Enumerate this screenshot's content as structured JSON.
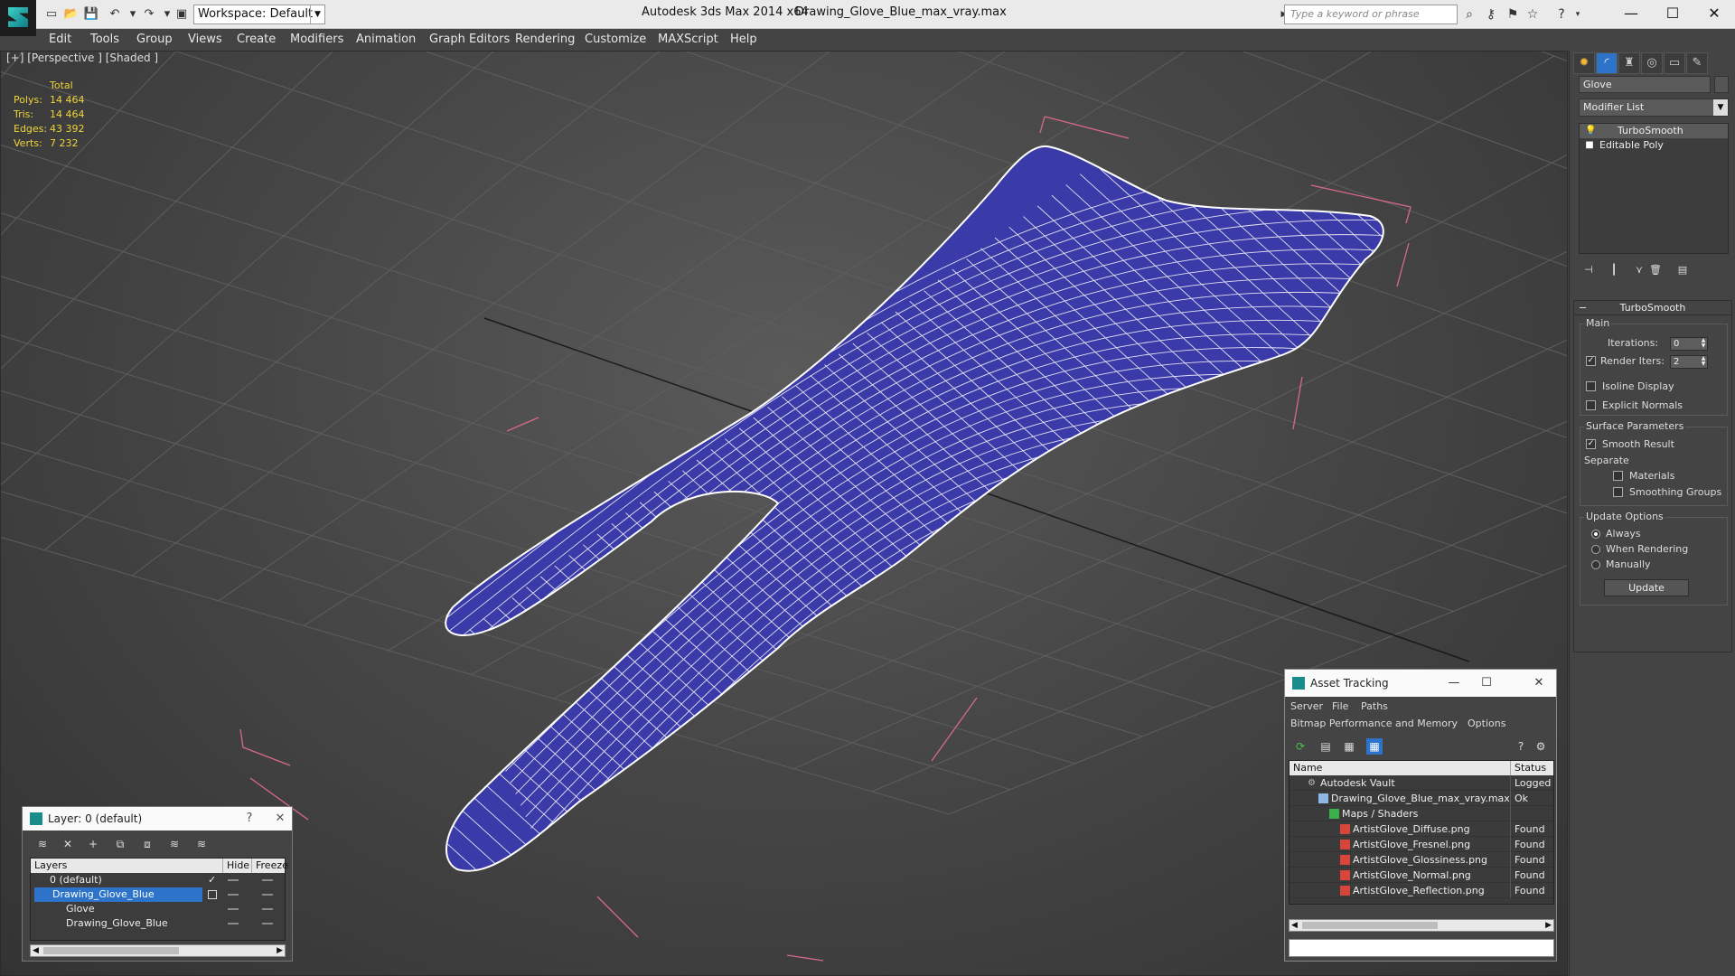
{
  "titlebar": {
    "workspace": "Workspace: Default",
    "app_title": "Autodesk 3ds Max  2014 x64",
    "doc_title": "Drawing_Glove_Blue_max_vray.max",
    "search_placeholder": "Type a keyword or phrase"
  },
  "menu": [
    "Edit",
    "Tools",
    "Group",
    "Views",
    "Create",
    "Modifiers",
    "Animation",
    "Graph Editors",
    "Rendering",
    "Customize",
    "MAXScript",
    "Help"
  ],
  "viewport": {
    "label": "[+] [Perspective ] [Shaded ]",
    "stats": {
      "header": "Total",
      "polys_label": "Polys:",
      "polys": "14 464",
      "tris_label": "Tris:",
      "tris": "14 464",
      "edges_label": "Edges:",
      "edges": "43 392",
      "verts_label": "Verts:",
      "verts": "7 232"
    },
    "mesh_color": "#3a3aa8",
    "wire_color": "#ffffff",
    "bbox_color": "#d86a86"
  },
  "command_panel": {
    "object_name": "Glove",
    "modifier_list": "Modifier List",
    "stack": [
      "TurboSmooth",
      "Editable Poly"
    ],
    "turbosmooth": {
      "title": "TurboSmooth",
      "main_label": "Main",
      "iterations_label": "Iterations:",
      "iterations": "0",
      "render_iters_label": "Render Iters:",
      "render_iters": "2",
      "isoline_label": "Isoline Display",
      "explicit_normals_label": "Explicit Normals",
      "surface_params_label": "Surface Parameters",
      "smooth_result_label": "Smooth Result",
      "separate_label": "Separate",
      "materials_label": "Materials",
      "smoothing_groups_label": "Smoothing Groups",
      "update_options_label": "Update Options",
      "always_label": "Always",
      "when_rendering_label": "When Rendering",
      "manually_label": "Manually",
      "update_button": "Update"
    }
  },
  "asset_tracking": {
    "title": "Asset Tracking",
    "menu": [
      "Server",
      "File",
      "Paths"
    ],
    "menu2": [
      "Bitmap Performance and Memory",
      "Options"
    ],
    "columns": [
      "Name",
      "Status"
    ],
    "rows": [
      {
        "name": "Autodesk Vault",
        "status": "Logged"
      },
      {
        "name": "Drawing_Glove_Blue_max_vray.max",
        "status": "Ok"
      },
      {
        "name": "Maps / Shaders",
        "status": ""
      },
      {
        "name": "ArtistGlove_Diffuse.png",
        "status": "Found"
      },
      {
        "name": "ArtistGlove_Fresnel.png",
        "status": "Found"
      },
      {
        "name": "ArtistGlove_Glossiness.png",
        "status": "Found"
      },
      {
        "name": "ArtistGlove_Normal.png",
        "status": "Found"
      },
      {
        "name": "ArtistGlove_Reflection.png",
        "status": "Found"
      }
    ]
  },
  "layer_window": {
    "title": "Layer: 0 (default)",
    "help": "?",
    "columns": [
      "Layers",
      "Hide",
      "Freeze"
    ],
    "rows": [
      {
        "name": "0 (default)"
      },
      {
        "name": "Drawing_Glove_Blue"
      },
      {
        "name": "Glove"
      },
      {
        "name": "Drawing_Glove_Blue"
      }
    ]
  }
}
